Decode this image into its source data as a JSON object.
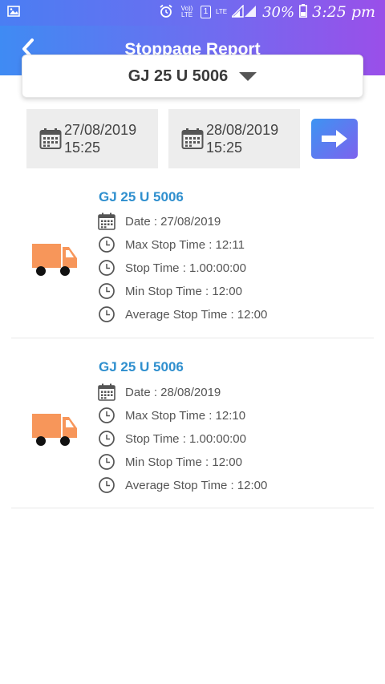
{
  "status_bar": {
    "volte": "Vo)) LTE",
    "sim": "1",
    "lte": "LTE",
    "battery": "30%",
    "time": "3:25 pm"
  },
  "header": {
    "title": "Stoppage Report"
  },
  "vehicle_select": {
    "selected": "GJ 25 U 5006"
  },
  "date_range": {
    "from_date": "27/08/2019",
    "from_time": "15:25",
    "to_date": "28/08/2019",
    "to_time": "15:25"
  },
  "records": [
    {
      "vehicle": "GJ 25 U 5006",
      "date": "Date : 27/08/2019",
      "max_stop": "Max Stop Time : 12:11",
      "stop": "Stop Time : 1.00:00:00",
      "min_stop": "Min Stop Time : 12:00",
      "avg_stop": "Average Stop Time : 12:00"
    },
    {
      "vehicle": "GJ 25 U 5006",
      "date": "Date : 28/08/2019",
      "max_stop": "Max Stop Time : 12:10",
      "stop": "Stop Time : 1.00:00:00",
      "min_stop": "Min Stop Time : 12:00",
      "avg_stop": "Average Stop Time : 12:00"
    }
  ],
  "colors": {
    "accent_blue": "#3f8bf3",
    "accent_purple": "#9a4fe9",
    "title_blue": "#2f8fce",
    "truck_orange": "#f7965a"
  }
}
